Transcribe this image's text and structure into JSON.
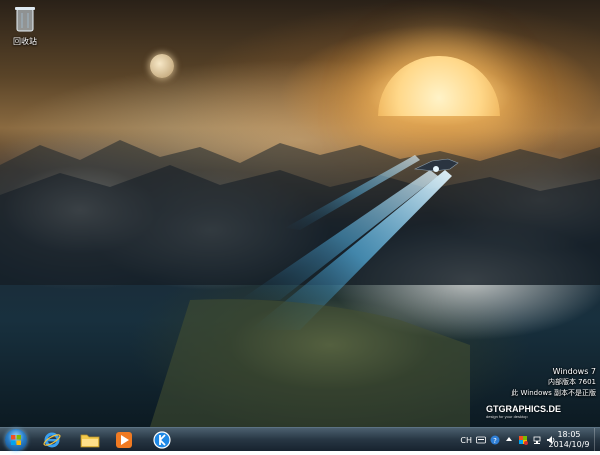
{
  "desktop": {
    "icons": [
      {
        "label": "回收站",
        "icon": "recycle-bin-icon"
      }
    ],
    "watermark": {
      "os_name": "Windows 7",
      "build_line": "内部版本 7601",
      "notice_line": "此 Windows 副本不是正版"
    },
    "wallpaper_logo": {
      "title": "GTGRAPHICS.DE",
      "subtitle": "design for your desktop"
    }
  },
  "taskbar": {
    "start": {
      "icon": "windows-start-orb-icon"
    },
    "pinned": [
      {
        "name": "Internet Explorer",
        "icon": "internet-explorer-icon"
      },
      {
        "name": "Windows Explorer",
        "icon": "folder-icon"
      },
      {
        "name": "Media Player",
        "icon": "media-player-icon"
      },
      {
        "name": "K App",
        "icon": "k-circle-icon"
      }
    ],
    "tray": {
      "language": "CH",
      "icons": [
        "keyboard-icon",
        "help-icon",
        "arrow-icon",
        "flag-icon",
        "network-icon",
        "volume-icon"
      ]
    },
    "clock": {
      "time": "18:05",
      "date": "2014/10/9"
    }
  },
  "colors": {
    "taskbar": "#1c2c3a",
    "beam": "#5ec8ff",
    "sun": "#ffd88a"
  }
}
